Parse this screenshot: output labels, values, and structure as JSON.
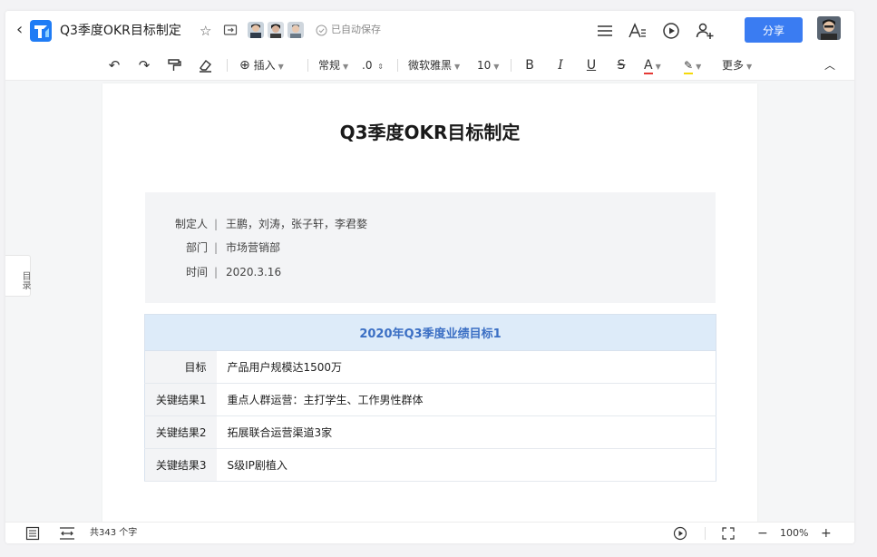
{
  "titlebar": {
    "back_icon": "chevron-left-icon",
    "doc_title": "Q3季度OKR目标制定",
    "saved_status": "已自动保存",
    "share_label": "分享"
  },
  "toolbar": {
    "insert_label": "插入",
    "style_label": "常规",
    "spacing_value": ".0",
    "font_name": "微软雅黑",
    "font_size": "10",
    "more_label": "更多",
    "font_color_accent": "#e53935",
    "highlight_accent": "#f5d90a"
  },
  "toc": {
    "label": "目录"
  },
  "document": {
    "title": "Q3季度OKR目标制定",
    "info": [
      {
        "label": "制定人",
        "sep": "|",
        "value": "王鹏，刘涛，张子轩，李君婺"
      },
      {
        "label": "部门",
        "sep": "|",
        "value": "市场营销部"
      },
      {
        "label": "时间",
        "sep": "|",
        "value": "2020.3.16"
      }
    ],
    "table": {
      "header": "2020年Q3季度业绩目标1",
      "rows": [
        {
          "key": "目标",
          "value": "产品用户规模达1500万"
        },
        {
          "key": "关键结果1",
          "value": "重点人群运营：主打学生、工作男性群体"
        },
        {
          "key": "关键结果2",
          "value": "拓展联合运营渠道3家"
        },
        {
          "key": "关键结果3",
          "value": "S级IP剧植入"
        }
      ]
    }
  },
  "statusbar": {
    "word_count": "共343 个字",
    "zoom": "100%"
  },
  "colors": {
    "accent": "#3a7cf2",
    "table_header_bg": "#ddebf9",
    "table_header_text": "#3b6fc4"
  }
}
